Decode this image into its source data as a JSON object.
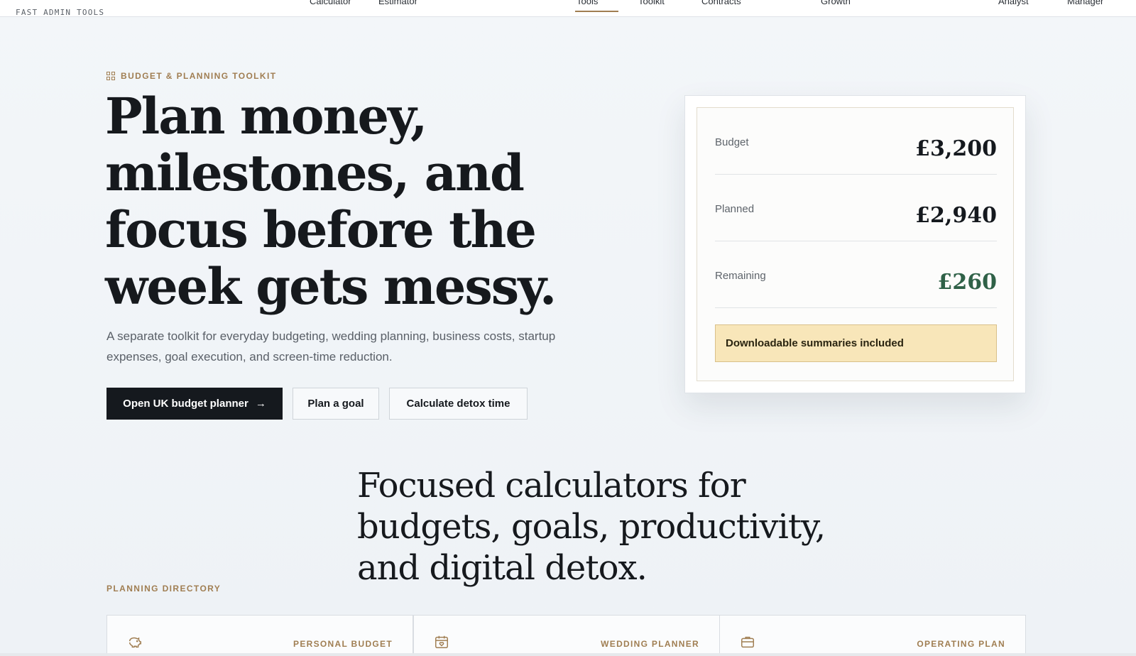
{
  "nav": {
    "brand": "FAST ADMIN TOOLS",
    "links": [
      "Calculator",
      "Estimator",
      "Tools",
      "Toolkit",
      "Contracts",
      "Growth",
      "Analyst",
      "Manager"
    ],
    "active_link": "Tools"
  },
  "hero": {
    "eyebrow": "BUDGET & PLANNING TOOLKIT",
    "title": "Plan money, milestones, and focus before the week gets messy.",
    "subtitle": "A separate toolkit for everyday budgeting, wedding planning, business costs, startup expenses, goal execution, and screen-time reduction.",
    "buttons": {
      "primary": "Open UK budget planner",
      "goal": "Plan a goal",
      "detox": "Calculate detox time"
    }
  },
  "summary_card": {
    "rows": [
      {
        "label": "Budget",
        "value": "£3,200"
      },
      {
        "label": "Planned",
        "value": "£2,940"
      },
      {
        "label": "Remaining",
        "value": "£260"
      }
    ],
    "note": "Downloadable summaries included"
  },
  "section": {
    "title": "Focused calculators for budgets, goals, productivity, and digital detox.",
    "directory_label": "PLANNING DIRECTORY",
    "cards": [
      {
        "icon": "piggy-bank-icon",
        "tag": "PERSONAL BUDGET"
      },
      {
        "icon": "calendar-heart-icon",
        "tag": "WEDDING PLANNER"
      },
      {
        "icon": "briefcase-icon",
        "tag": "OPERATING PLAN"
      }
    ]
  },
  "colors": {
    "accent_gold": "#a07e52",
    "primary_dark": "#15191e",
    "positive_green": "#2f6147",
    "note_background": "#f8e6b9"
  }
}
